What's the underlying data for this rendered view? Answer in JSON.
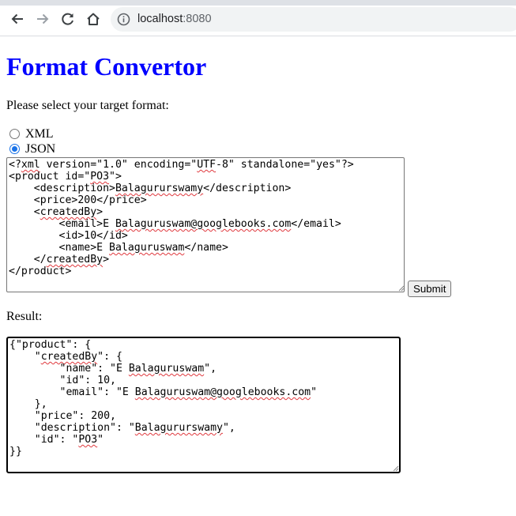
{
  "browser": {
    "url_host": "localhost",
    "url_port": ":8080",
    "icons": [
      "back-arrow-icon",
      "forward-arrow-icon",
      "reload-icon",
      "home-icon",
      "info-icon"
    ]
  },
  "page": {
    "title": "Format Convertor",
    "prompt": "Please select your target format:",
    "formats": [
      {
        "label": "XML",
        "checked": false
      },
      {
        "label": "JSON",
        "checked": true
      }
    ],
    "submit_label": "Submit",
    "result_label": "Result:"
  },
  "input_xml": "<?xml version=\"1.0\" encoding=\"UTF-8\" standalone=\"yes\"?>\n<product id=\"PO3\">\n    <description>Balagururswamy</description>\n    <price>200</price>\n    <createdBy>\n        <email>E Balaguruswam@googlebooks.com</email>\n        <id>10</id>\n        <name>E Balaguruswam</name>\n    </createdBy>\n</product>",
  "result_json": "{\"product\": {\n    \"createdBy\": {\n        \"name\": \"E Balaguruswam\",\n        \"id\": 10,\n        \"email\": \"E Balaguruswam@googlebooks.com\"\n    },\n    \"price\": 200,\n    \"description\": \"Balagururswamy\",\n    \"id\": \"PO3\"\n}}",
  "spellcheck_words": [
    "xml",
    "UTF",
    "PO3",
    "Balagururswamy",
    "createdBy",
    "Balaguruswam",
    "Balaguruswam@googlebooks.com"
  ],
  "colors": {
    "title": "#0000ff",
    "radio_accent": "#1a73e8",
    "spellcheck": "#e0393e"
  }
}
